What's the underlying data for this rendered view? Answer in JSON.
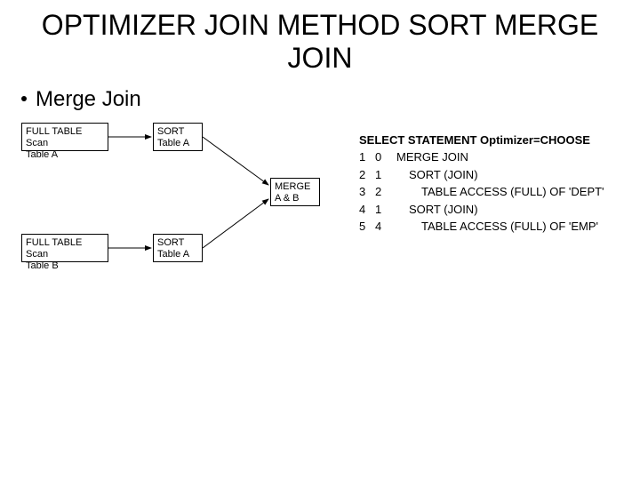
{
  "title": "OPTIMIZER JOIN METHOD SORT MERGE JOIN",
  "bullet": "Merge Join",
  "diagram": {
    "boxes": {
      "scanA": {
        "l1": "FULL TABLE Scan",
        "l2": "Table A"
      },
      "sortA": {
        "l1": "SORT",
        "l2": "Table A"
      },
      "scanB": {
        "l1": "FULL TABLE Scan",
        "l2": "Table B"
      },
      "sortB": {
        "l1": "SORT",
        "l2": "Table A"
      },
      "merge": {
        "l1": "MERGE",
        "l2": "A & B"
      }
    }
  },
  "plan": {
    "header": "SELECT STATEMENT Optimizer=CHOOSE",
    "rows": [
      {
        "id": "1",
        "pid": "0",
        "op": "MERGE JOIN",
        "indent": 0
      },
      {
        "id": "2",
        "pid": "1",
        "op": "SORT (JOIN)",
        "indent": 1
      },
      {
        "id": "3",
        "pid": "2",
        "op": "TABLE ACCESS (FULL) OF 'DEPT'",
        "indent": 2
      },
      {
        "id": "4",
        "pid": "1",
        "op": "SORT (JOIN)",
        "indent": 1
      },
      {
        "id": "5",
        "pid": "4",
        "op": "TABLE ACCESS (FULL) OF 'EMP'",
        "indent": 2
      }
    ]
  }
}
